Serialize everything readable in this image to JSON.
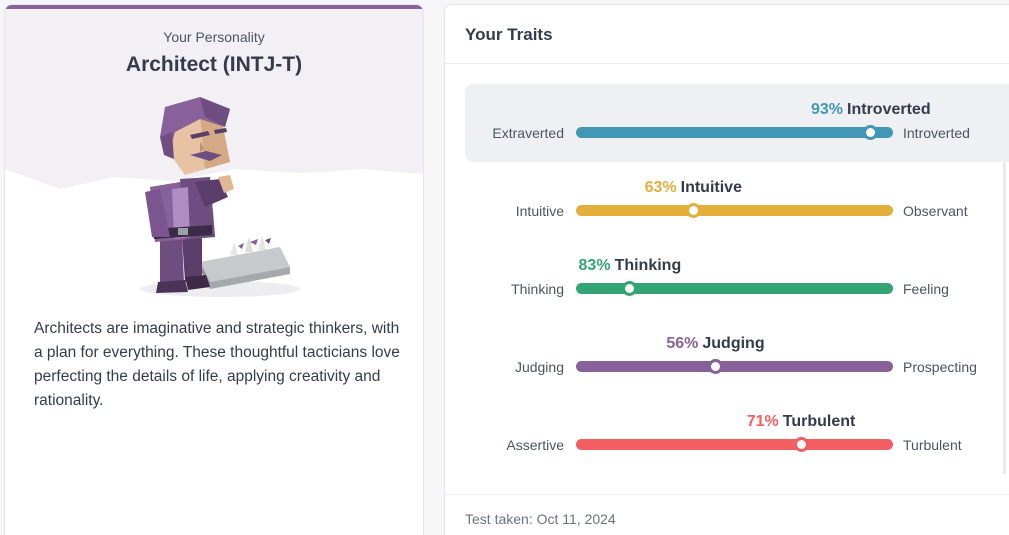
{
  "personality": {
    "eyebrow": "Your Personality",
    "title": "Architect (INTJ-T)",
    "description": "Architects are imaginative and strategic thinkers, with a plan for everything. These thoughtful tacticians love perfecting the details of life, applying creativity and rationality."
  },
  "traits_card": {
    "title": "Your Traits",
    "test_taken": "Test taken: Oct 11, 2024",
    "traits": [
      {
        "pct": "93%",
        "name": "Introverted",
        "left_label": "Extraverted",
        "right_label": "Introverted",
        "position": 0.93,
        "color": "#4298b4",
        "highlighted": true
      },
      {
        "pct": "63%",
        "name": "Intuitive",
        "left_label": "Intuitive",
        "right_label": "Observant",
        "position": 0.37,
        "color": "#e4ae3a",
        "highlighted": false
      },
      {
        "pct": "83%",
        "name": "Thinking",
        "left_label": "Thinking",
        "right_label": "Feeling",
        "position": 0.17,
        "color": "#33a474",
        "highlighted": false
      },
      {
        "pct": "56%",
        "name": "Judging",
        "left_label": "Judging",
        "right_label": "Prospecting",
        "position": 0.44,
        "color": "#88619a",
        "highlighted": false
      },
      {
        "pct": "71%",
        "name": "Turbulent",
        "left_label": "Assertive",
        "right_label": "Turbulent",
        "position": 0.71,
        "color": "#f25e62",
        "highlighted": false
      }
    ]
  },
  "colors": {
    "accent": "#88619a",
    "header_bg": "#f2eff5"
  },
  "icons": {
    "avatar": "architect-character-illustration"
  }
}
